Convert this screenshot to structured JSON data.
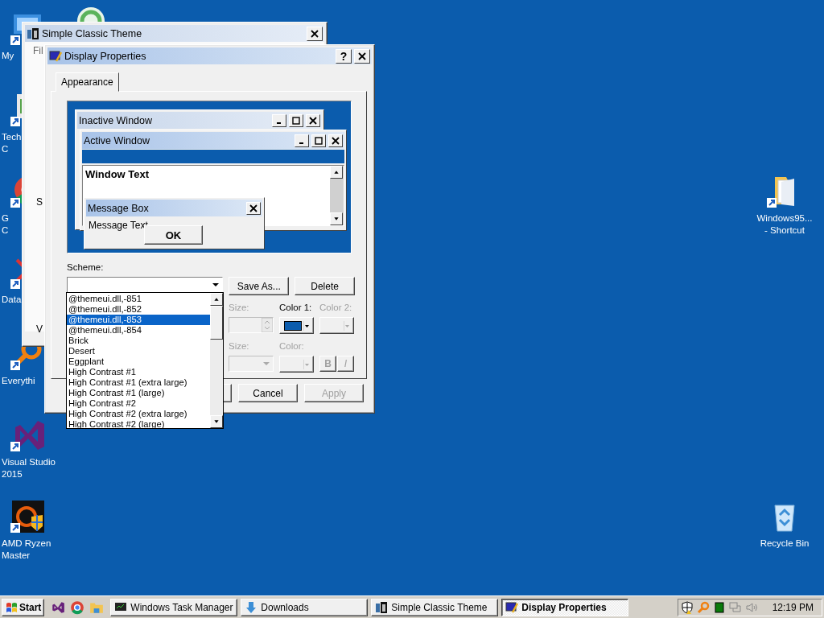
{
  "desktop": {
    "left_icons": [
      {
        "kind": "computer",
        "lines": [
          "My"
        ]
      },
      {
        "kind": "app",
        "lines": [
          "Tech",
          "C"
        ]
      },
      {
        "kind": "chrome",
        "lines": [
          "G",
          "C"
        ]
      },
      {
        "kind": "data",
        "lines": [
          "Data"
        ]
      },
      {
        "kind": "search",
        "lines": [
          "Everythi"
        ]
      },
      {
        "kind": "vs",
        "lines": [
          "Visual Studio",
          "2015"
        ]
      },
      {
        "kind": "ryzen",
        "lines": [
          "AMD Ryzen",
          "Master"
        ]
      }
    ],
    "right_icons": [
      {
        "kind": "folder",
        "lines": [
          "Windows95...",
          "- Shortcut"
        ]
      },
      {
        "kind": "recycle",
        "lines": [
          "Recycle Bin"
        ]
      }
    ]
  },
  "background_window": {
    "title": "Simple Classic Theme",
    "menu": "Fil",
    "side_labels": [
      "S",
      "V"
    ]
  },
  "dialog": {
    "title": "Display Properties",
    "help": "?",
    "tabs": [
      {
        "label": "Appearance",
        "selected": true
      }
    ],
    "preview": {
      "inactive_title": "Inactive Window",
      "active_title": "Active Window",
      "window_text": "Window Text",
      "message_title": "Message Box",
      "message_text": "Message Text",
      "ok": "OK"
    },
    "scheme_label": "Scheme:",
    "scheme_buttons": [
      "Save As...",
      "Delete"
    ],
    "item_controls": [
      {
        "kind": "spin",
        "label": "Size:",
        "disabled": true
      },
      {
        "kind": "color",
        "label": "Color 1:",
        "disabled": false,
        "color": "#0b5cad"
      },
      {
        "kind": "color",
        "label": "Color 2:",
        "disabled": true
      }
    ],
    "font_controls": [
      {
        "kind": "combo",
        "label": "Size:",
        "disabled": true
      },
      {
        "kind": "color",
        "label": "Color:",
        "disabled": true
      },
      {
        "kind": "toggles",
        "labels": [
          "B",
          "I"
        ],
        "disabled": true
      }
    ],
    "footer_buttons": [
      {
        "label": "Cancel",
        "disabled": false
      },
      {
        "label": "Apply",
        "disabled": true
      }
    ],
    "scheme_list": [
      {
        "label": "@themeui.dll,-851",
        "selected": false
      },
      {
        "label": "@themeui.dll,-852",
        "selected": false
      },
      {
        "label": "@themeui.dll,-853",
        "selected": true
      },
      {
        "label": "@themeui.dll,-854",
        "selected": false
      },
      {
        "label": "Brick",
        "selected": false
      },
      {
        "label": "Desert",
        "selected": false
      },
      {
        "label": "Eggplant",
        "selected": false
      },
      {
        "label": "High Contrast #1",
        "selected": false
      },
      {
        "label": "High Contrast #1 (extra large)",
        "selected": false
      },
      {
        "label": "High Contrast #1 (large)",
        "selected": false
      },
      {
        "label": "High Contrast #2",
        "selected": false
      },
      {
        "label": "High Contrast #2 (extra large)",
        "selected": false
      },
      {
        "label": "High Contrast #2 (large)",
        "selected": false
      }
    ]
  },
  "taskbar": {
    "start": "Start",
    "tasks": [
      {
        "label": "Windows Task Manager",
        "kind": "monitor",
        "selected": false
      },
      {
        "label": "Downloads",
        "kind": "download",
        "selected": false
      },
      {
        "label": "Simple Classic Theme",
        "kind": "theme",
        "selected": false
      },
      {
        "label": "Display Properties",
        "kind": "display",
        "selected": true
      }
    ],
    "clock": "12:19 PM"
  }
}
